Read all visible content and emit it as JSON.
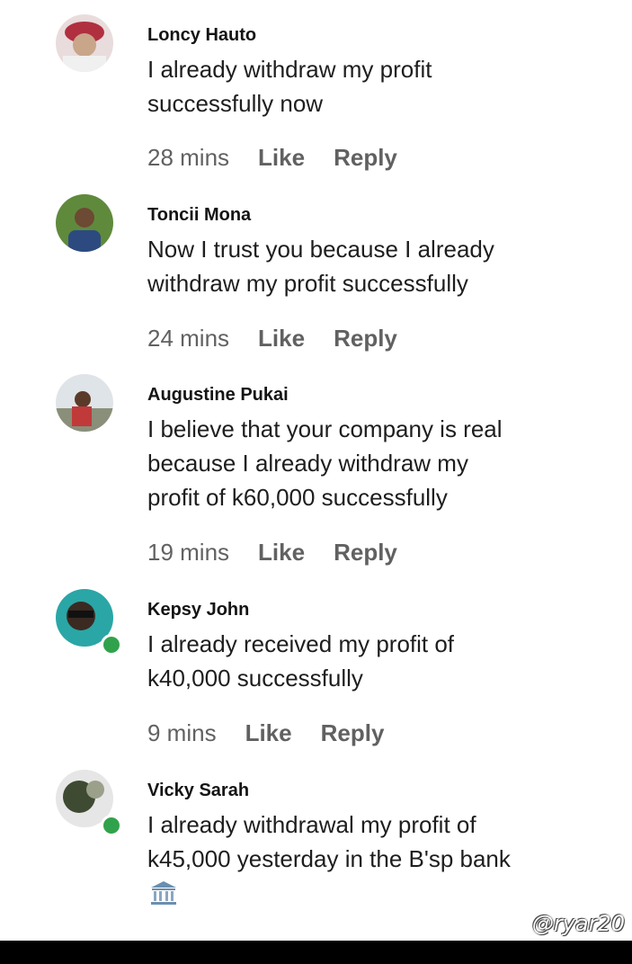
{
  "comments": [
    {
      "author": "Loncy Hauto",
      "text_lines": [
        "I already withdraw my profit",
        "successfully now"
      ],
      "time": "28 mins",
      "like_label": "Like",
      "reply_label": "Reply",
      "online": false
    },
    {
      "author": "Toncii Mona",
      "text_lines": [
        "Now I trust you because I already",
        "withdraw my profit successfully"
      ],
      "time": "24 mins",
      "like_label": "Like",
      "reply_label": "Reply",
      "online": false
    },
    {
      "author": "Augustine Pukai",
      "text_lines": [
        "I believe that your company is real",
        "because I already withdraw my",
        "profit of k60,000 successfully"
      ],
      "time": "19 mins",
      "like_label": "Like",
      "reply_label": "Reply",
      "online": false
    },
    {
      "author": "Kepsy John",
      "text_lines": [
        "I already received my profit of",
        "k40,000 successfully"
      ],
      "time": "9 mins",
      "like_label": "Like",
      "reply_label": "Reply",
      "online": true
    },
    {
      "author": "Vicky Sarah",
      "text_lines": [
        "I already withdrawal my profit of",
        "k45,000 yesterday in the B'sp bank"
      ],
      "attachment_icon": "bank-icon",
      "online": true
    }
  ],
  "watermark": "@ryar20",
  "colors": {
    "online": "#31a24c",
    "meta": "#616161"
  }
}
